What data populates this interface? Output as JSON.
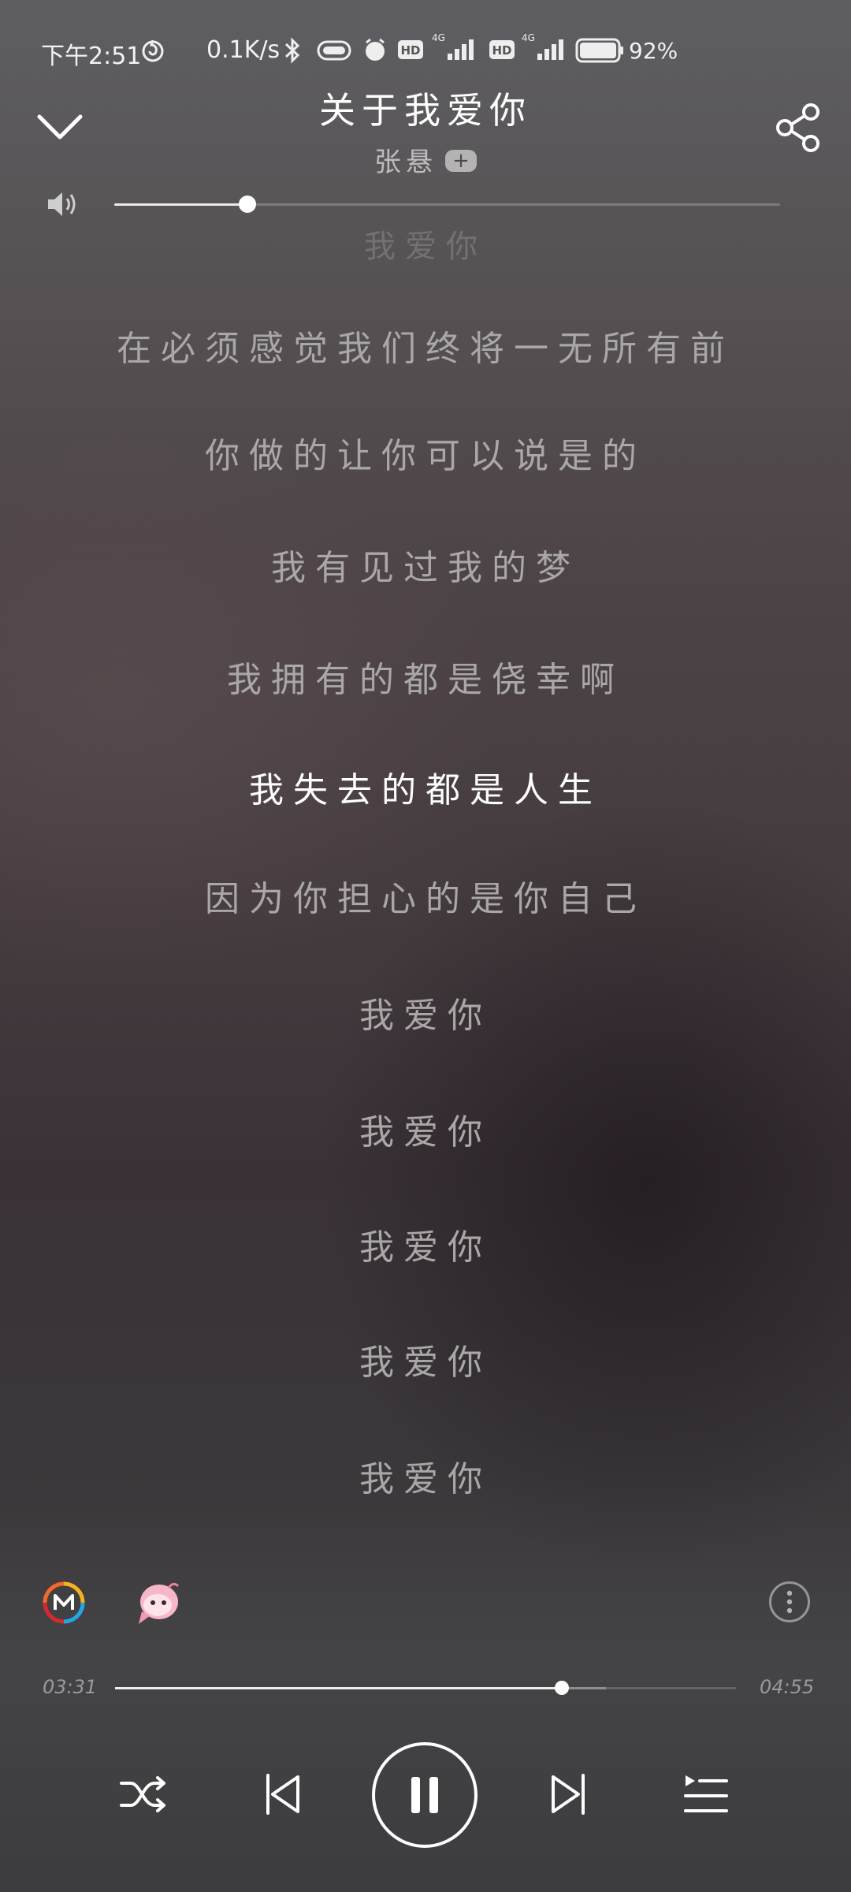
{
  "status_bar": {
    "time": "下午2:51",
    "network_speed": "0.1K/s",
    "battery_percent": "92%",
    "icons": [
      "netease-music-icon",
      "bluetooth-icon",
      "toggle-pill-icon",
      "alarm-icon",
      "hd-icon",
      "signal-4g-icon",
      "hd-icon",
      "signal-4g-icon",
      "battery-icon"
    ]
  },
  "header": {
    "song_title": "关于我爱你",
    "artist": "张悬",
    "follow_label": "+"
  },
  "volume": {
    "level": 0.2
  },
  "lyrics": {
    "previous_partial": "我爱你",
    "lines": [
      "在必须感觉我们终将一无所有前",
      "你做的让你可以说是的",
      "我有见过我的梦",
      "我拥有的都是侥幸啊",
      "我失去的都是人生",
      "因为你担心的是你自己",
      "我爱你",
      "我爱你",
      "我爱你",
      "我爱你",
      "我爱你"
    ],
    "current_index": 4
  },
  "playback": {
    "elapsed": "03:31",
    "duration": "04:55",
    "progress": 0.72,
    "buffered": 0.79
  },
  "icons": {
    "collapse": "chevron-down-icon",
    "share": "share-icon",
    "volume": "speaker-icon",
    "shuffle": "shuffle-icon",
    "previous": "previous-track-icon",
    "pause": "pause-icon",
    "next": "next-track-icon",
    "playlist": "playlist-icon",
    "more": "more-vertical-icon"
  },
  "colors": {
    "accent": "#ffffff",
    "lyric_inactive": "#a9a7a8",
    "lyric_active": "#ffffff"
  }
}
